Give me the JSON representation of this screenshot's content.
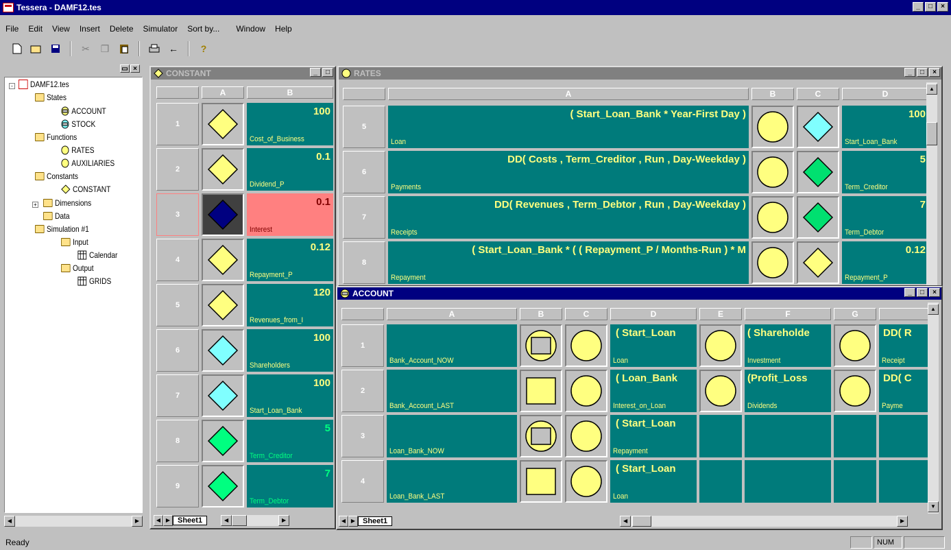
{
  "app": {
    "title": "Tessera - DAMF12.tes"
  },
  "menu": [
    "File",
    "Edit",
    "View",
    "Insert",
    "Delete",
    "Simulator",
    "Sort by...",
    "Window",
    "Help"
  ],
  "toolbar": {
    "icons": [
      "new-icon",
      "open-icon",
      "save-icon",
      "cut-icon",
      "copy-icon",
      "paste-icon",
      "print-icon",
      "back-arrow-icon",
      "help-icon"
    ]
  },
  "tree": {
    "root": "DAMF12.tes",
    "states": "States",
    "account": "ACCOUNT",
    "stock": "STOCK",
    "functions": "Functions",
    "rates": "RATES",
    "auxiliaries": "AUXILIARIES",
    "constants": "Constants",
    "constant": "CONSTANT",
    "dimensions": "Dimensions",
    "data": "Data",
    "simulation": "Simulation #1",
    "input": "Input",
    "calendar": "Calendar",
    "output": "Output",
    "grids": "GRIDS"
  },
  "constant_win": {
    "title": "CONSTANT",
    "col_a": "A",
    "col_b": "B",
    "sheet": "Sheet1",
    "rows": [
      {
        "num": "1",
        "value": "100",
        "name": "Cost_of_Business",
        "shape": "diamond",
        "color": "#ffff80",
        "style": ""
      },
      {
        "num": "2",
        "value": "0.1",
        "name": "Dividend_P",
        "shape": "diamond",
        "color": "#ffff80",
        "style": ""
      },
      {
        "num": "3",
        "value": "0.1",
        "name": "Interest",
        "shape": "diamond",
        "color": "#000080",
        "style": "pink"
      },
      {
        "num": "4",
        "value": "0.12",
        "name": "Repayment_P",
        "shape": "diamond",
        "color": "#ffff80",
        "style": ""
      },
      {
        "num": "5",
        "value": "120",
        "name": "Revenues_from_I",
        "shape": "diamond",
        "color": "#ffff80",
        "style": ""
      },
      {
        "num": "6",
        "value": "100",
        "name": "Shareholders",
        "shape": "diamond",
        "color": "#80ffff",
        "style": ""
      },
      {
        "num": "7",
        "value": "100",
        "name": "Start_Loan_Bank",
        "shape": "diamond",
        "color": "#80ffff",
        "style": ""
      },
      {
        "num": "8",
        "value": "5",
        "name": "Term_Creditor",
        "shape": "diamond",
        "color": "#00ff80",
        "style": "green"
      },
      {
        "num": "9",
        "value": "7",
        "name": "Term_Debtor",
        "shape": "diamond",
        "color": "#00ff80",
        "style": "green"
      }
    ]
  },
  "rates_win": {
    "title": "RATES",
    "cols": [
      "A",
      "B",
      "C",
      "D"
    ],
    "rows": [
      {
        "num": "5",
        "formula": "( Start_Loan_Bank * Year-First Day )",
        "name": "Loan",
        "diamond": "#80ffff",
        "dval": "100",
        "dname": "Start_Loan_Bank"
      },
      {
        "num": "6",
        "formula": "DD( Costs , Term_Creditor , Run , Day-Weekday )",
        "name": "Payments",
        "diamond": "#00e070",
        "dval": "5",
        "dname": "Term_Creditor"
      },
      {
        "num": "7",
        "formula": "DD( Revenues , Term_Debtor , Run , Day-Weekday )",
        "name": "Receipts",
        "diamond": "#00e070",
        "dval": "7",
        "dname": "Term_Debtor"
      },
      {
        "num": "8",
        "formula": "( Start_Loan_Bank * ( ( Repayment_P / Months-Run ) * M",
        "name": "Repayment",
        "diamond": "#ffff80",
        "dval": "0.12",
        "dname": "Repayment_P"
      }
    ]
  },
  "account_win": {
    "title": "ACCOUNT",
    "cols": [
      "A",
      "B",
      "C",
      "D",
      "E",
      "F",
      "G",
      ""
    ],
    "sheet": "Sheet1",
    "rows": [
      {
        "num": "1",
        "a": "Bank_Account_NOW",
        "b": "circle-square",
        "d_val": "( Start_Loan",
        "d_nm": "Loan",
        "e": "circle",
        "f_val": "( Shareholde",
        "f_nm": "Investment",
        "g": "circle",
        "h_val": "DD( R",
        "h_nm": "Receipt"
      },
      {
        "num": "2",
        "a": "Bank_Account_LAST",
        "b": "square",
        "d_val": "( Loan_Bank",
        "d_nm": "Interest_on_Loan",
        "e": "circle",
        "f_val": "(Profit_Loss",
        "f_nm": "Dividends",
        "g": "circle",
        "h_val": "DD( C",
        "h_nm": "Payme"
      },
      {
        "num": "3",
        "a": "Loan_Bank_NOW",
        "b": "circle-square",
        "d_val": "( Start_Loan",
        "d_nm": "Repayment",
        "e": "",
        "f_val": "",
        "f_nm": "",
        "g": "",
        "h_val": "",
        "h_nm": ""
      },
      {
        "num": "4",
        "a": "Loan_Bank_LAST",
        "b": "square",
        "d_val": "( Start_Loan",
        "d_nm": "Loan",
        "e": "",
        "f_val": "",
        "f_nm": "",
        "g": "",
        "h_val": "",
        "h_nm": ""
      }
    ]
  },
  "status": {
    "text": "Ready",
    "num": "NUM"
  }
}
